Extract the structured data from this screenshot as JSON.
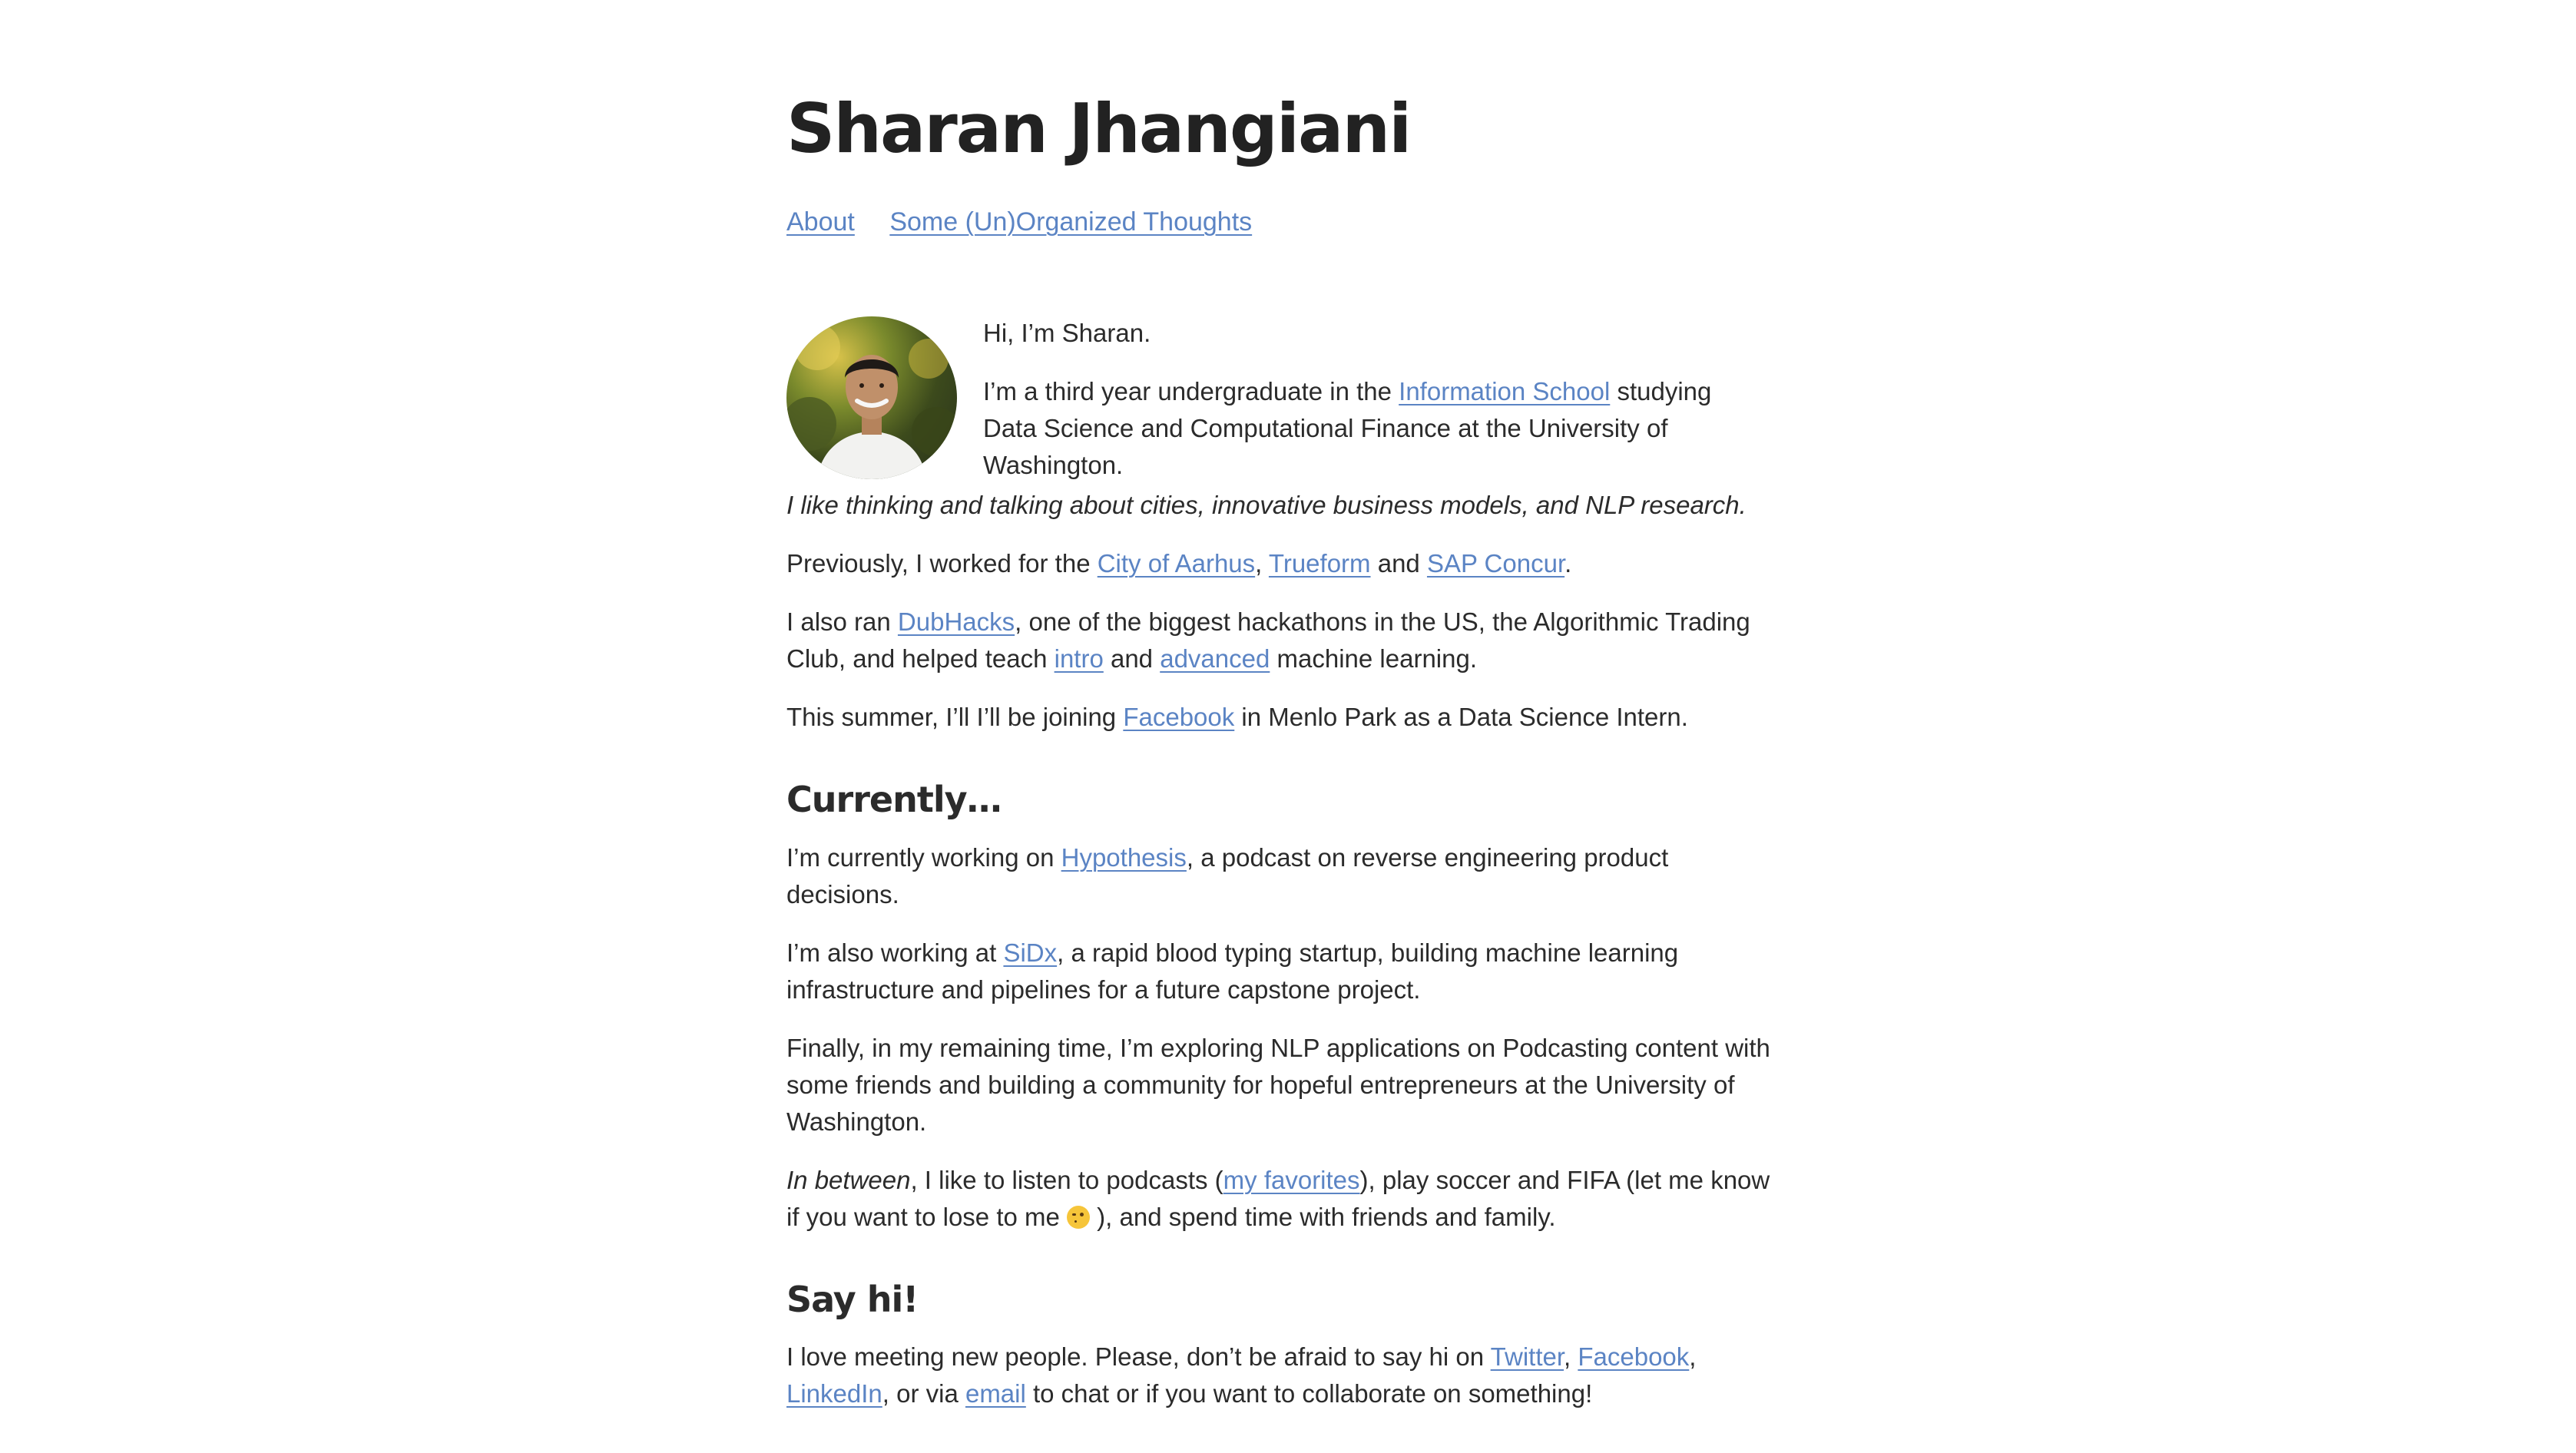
{
  "site": {
    "title": "Sharan Jhangiani"
  },
  "nav": {
    "about": "About",
    "thoughts": "Some (Un)Organized Thoughts"
  },
  "avatar": {
    "icon": "profile-photo"
  },
  "intro": {
    "greeting": "Hi, I’m Sharan.",
    "p1_a": "I’m a third year undergraduate in the ",
    "p1_link": "Information School",
    "p1_b": " studying Data Science and Computational Finance at the University of Washington."
  },
  "tagline": "I like thinking and talking about cities, innovative business models, and NLP research.",
  "previously": {
    "a": "Previously, I worked for the ",
    "link1": "City of Aarhus",
    "sep1": ", ",
    "link2": "Trueform",
    "sep2": " and ",
    "link3": "SAP Concur",
    "end": "."
  },
  "alsoran": {
    "a": "I also ran ",
    "link1": "DubHacks",
    "b": ", one of the biggest hackathons in the US, the Algorithmic Trading Club, and helped teach ",
    "link2": "intro",
    "c": " and ",
    "link3": "advanced",
    "d": " machine learning."
  },
  "summer": {
    "a": "This summer, I’ll I’ll be joining ",
    "link": "Facebook",
    "b": " in Menlo Park as a Data Science Intern."
  },
  "currently": {
    "heading": "Currently…",
    "p1_a": "I’m currently working on ",
    "p1_link": "Hypothesis",
    "p1_b": ", a podcast on reverse engineering product decisions.",
    "p2_a": "I’m also working at ",
    "p2_link": "SiDx",
    "p2_b": ", a rapid blood typing startup, building machine learning infrastructure and pipelines for a future capstone project.",
    "p3": "Finally, in my remaining time, I’m exploring NLP applications on Podcasting content with some friends and building a community for hopeful entrepreneurs at the University of Washington.",
    "p4_em": "In between",
    "p4_a": ", I like to listen to podcasts (",
    "p4_link": "my favorites",
    "p4_b": "), play soccer and FIFA (let me know if you want to lose to me ",
    "p4_c": " ), and spend time with friends and family."
  },
  "sayhi": {
    "heading": "Say hi!",
    "a": "I love meeting new people. Please, don’t be afraid to say hi on ",
    "link1": "Twitter",
    "sep1": ", ",
    "link2": "Facebook",
    "sep2": ", ",
    "link3": "LinkedIn",
    "b": ", or via ",
    "link4": "email",
    "c": " to chat or if you want to collaborate on something!"
  }
}
